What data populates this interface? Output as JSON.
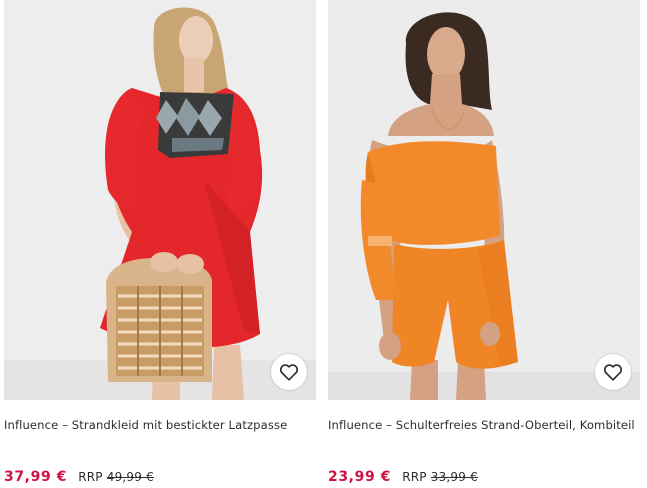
{
  "colors": {
    "sale_price": "#d01345",
    "text": "#2d2d2d",
    "save_button_bg": "#ffffff"
  },
  "products": [
    {
      "title": "Influence – Strandkleid mit bestickter Latzpasse",
      "price_now": "37,99 €",
      "rrp_label": "RRP",
      "price_old": "49,99 €",
      "save_icon": "heart-outline-icon"
    },
    {
      "title": "Influence – Schulterfreies Strand-Oberteil, Kombiteil",
      "price_now": "23,99 €",
      "rrp_label": "RRP",
      "price_old": "33,99 €",
      "save_icon": "heart-outline-icon"
    }
  ]
}
